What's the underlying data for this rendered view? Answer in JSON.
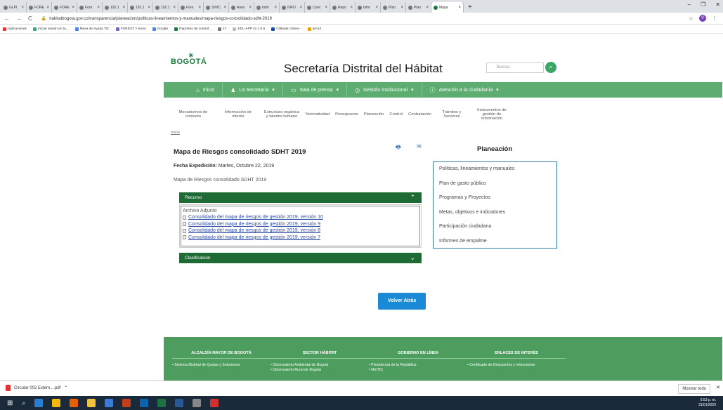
{
  "browser": {
    "tabs": [
      "GLPI",
      "FORE",
      "FORE",
      "Fore",
      "192.1",
      "192.1",
      "192.1",
      "Fore",
      "SIVIC",
      "Anex",
      "Infor",
      "INFO",
      "Conc",
      "Repo",
      "Infor",
      "Plan",
      "Plan",
      "Mapa"
    ],
    "active_tab": "Mapa",
    "new_tab": "+",
    "url": "habitatbogota.gov.co/transparencia/planeacion/politicas-lineamientos-y-manuales/mapa-riesgos-consolidado-sdht-2019",
    "avatar": "V",
    "bookmarks": [
      "Aplicaciones",
      "Iniciar sesión en la...",
      "Mesa de Ayuda TIC",
      "FOREST > Inicio",
      "Google",
      "Reportes de control...",
      "47",
      "EDL-APP v2.1.6.6",
      "Citibank Online -",
      "armul"
    ]
  },
  "site": {
    "logo": "BOGOTÁ",
    "title": "Secretaría Distrital del Hábitat",
    "search_placeholder": "Buscar",
    "nav": [
      {
        "label": "Inicio",
        "icon": "home-icon"
      },
      {
        "label": "La Secretaría",
        "icon": "user-icon"
      },
      {
        "label": "Sala de prensa",
        "icon": "monitor-icon"
      },
      {
        "label": "Gestión Institucional",
        "icon": "clock-icon"
      },
      {
        "label": "Atención a la ciudadanía",
        "icon": "info-icon"
      }
    ],
    "subnav": [
      "Mecanismos de contacto",
      "Información de interés",
      "Estructura orgánica y talento humano",
      "Normatividad",
      "Presupuesto",
      "Planeación",
      "Control",
      "Contratación",
      "Trámites y Servicios",
      "Instrumentos de gestión de información"
    ]
  },
  "content": {
    "breadcrumb": "Inicio",
    "title": "Mapa de Riesgos consolidado SDHT 2019",
    "fecha_label": "Fecha Expedición:",
    "fecha_value": "Martes, Octubre 22, 2019",
    "description": "Mapa de Riesgos consolidado SDHT 2019",
    "recurso_label": "Recurso",
    "attach_title": "Archivo Adjunto",
    "files": [
      "Consolidado del mapa de riesgos de gestión 2019, versión 10",
      "Consolidado del mapa de riesgos de gestión 2019, versión 9",
      "Consolidado del mapa de riesgos de gestión 2019, versión 8",
      "Consolidado del mapa de riesgos de gestión 2019, versión 7"
    ],
    "clasificacion_label": "Clasificacion",
    "back_button": "Volver Atrás"
  },
  "sidebar": {
    "title": "Planeación",
    "links": [
      "Políticas, lineamientos y manuales",
      "Plan de gasto público",
      "Programas y Proyectos",
      "Metas, objetivos e indicadores",
      "Participación ciudadana",
      "Informes de empalme"
    ]
  },
  "footer": {
    "columns": [
      {
        "title": "ALCALDÍA MAYOR DE BOGOTÁ",
        "items": [
          "• Sistema Distrital de Quejas y Soluciones"
        ]
      },
      {
        "title": "SECTOR HÁBITAT",
        "items": [
          "• Observatorio Ambiental de Bogotá",
          "• Observatorio Rural de Bogotá"
        ]
      },
      {
        "title": "GOBIERNO EN LÍNEA",
        "items": [
          "• Presidencia de la República",
          "• MinTIC"
        ]
      },
      {
        "title": "ENLACES DE INTERÉS",
        "items": [
          "• Certificado de Descuentos y retenciones"
        ]
      }
    ]
  },
  "downloads": {
    "file": "Circular 002 Extern....pdf",
    "show_all": "Mostrar todo"
  },
  "taskbar": {
    "time": "5:53 p. m.",
    "date": "31/01/2020"
  },
  "colors": {
    "green": "#5dad70",
    "dark_green": "#1e6b36",
    "blue_button": "#1a8ad6"
  }
}
